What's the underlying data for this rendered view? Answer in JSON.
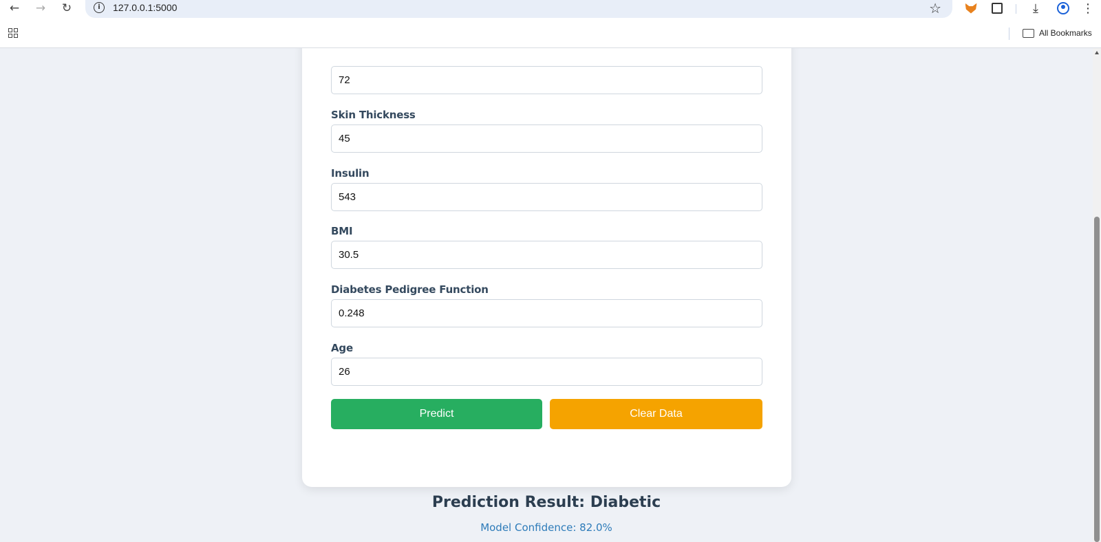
{
  "browser": {
    "url": "127.0.0.1:5000",
    "bookmarks_label": "All Bookmarks",
    "icons": [
      "back-icon",
      "forward-icon",
      "reload-icon",
      "info-icon",
      "star-icon",
      "metamask-icon",
      "extensions-icon",
      "download-icon",
      "profile-icon",
      "menu-icon",
      "apps-icon",
      "folder-icon"
    ]
  },
  "form": {
    "fields": [
      {
        "label": "",
        "value": "72"
      },
      {
        "label": "Skin Thickness",
        "value": "45"
      },
      {
        "label": "Insulin",
        "value": "543"
      },
      {
        "label": "BMI",
        "value": "30.5"
      },
      {
        "label": "Diabetes Pedigree Function",
        "value": "0.248"
      },
      {
        "label": "Age",
        "value": "26"
      }
    ],
    "predict_label": "Predict",
    "clear_label": "Clear Data"
  },
  "result": {
    "title": "Prediction Result: Diabetic",
    "confidence": "Model Confidence: 82.0%"
  },
  "colors": {
    "predict": "#27ae60",
    "clear": "#f5a300",
    "background": "#eef1f6",
    "confidence_text": "#2d7bb9"
  }
}
